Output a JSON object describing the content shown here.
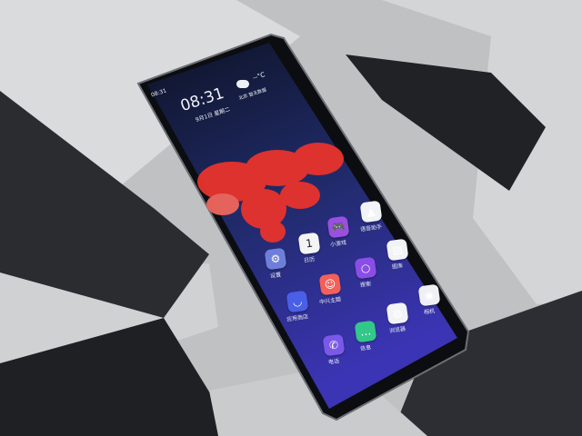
{
  "status_bar": {
    "time": "08:31"
  },
  "clock": {
    "time": "08:31",
    "date": "9月1日 星期二"
  },
  "weather": {
    "temperature": "--°C",
    "location_status": "北京 暂无数据",
    "icon": "partly-cloudy-icon"
  },
  "apps": [
    {
      "label": "设置",
      "icon": "gear-icon",
      "color": "#6d7fd8"
    },
    {
      "label": "日历",
      "icon": "calendar-icon",
      "color": "#f4f4f6",
      "day": "1"
    },
    {
      "label": "小游戏",
      "icon": "gamepad-icon",
      "color": "#9a4fe0"
    },
    {
      "label": "语音助手",
      "icon": "voice-assistant-icon",
      "color": "#f2f3f7"
    },
    {
      "label": "图库",
      "icon": "gallery-icon",
      "color": "#f2f3f7"
    },
    {
      "label": "搜索",
      "icon": "search-icon",
      "color": "#8a4de6"
    },
    {
      "label": "中兴主题",
      "icon": "palette-icon",
      "color": "#f2605a"
    },
    {
      "label": "应用商店",
      "icon": "store-bag-icon",
      "color": "#4a5fe6"
    },
    {
      "label": "相机",
      "icon": "camera-icon",
      "color": "#eef0f6"
    },
    {
      "label": "浏览器",
      "icon": "globe-icon",
      "color": "#f2f3f7"
    },
    {
      "label": "信息",
      "icon": "chat-bubble-icon",
      "color": "#33c78a"
    },
    {
      "label": "电话",
      "icon": "phone-icon",
      "color": "#7a58e8"
    }
  ],
  "colors": {
    "background": "#bfc1c3",
    "screen_top": "#111830",
    "screen_bottom": "#3a3ab0",
    "wallpaper_cloud": "#e8332c"
  }
}
